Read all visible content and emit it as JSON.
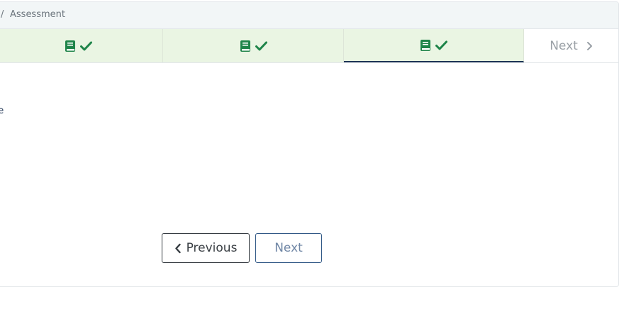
{
  "breadcrumb": {
    "separator": "/",
    "current": "Assessment"
  },
  "tabs": [
    {
      "icon": "book-icon",
      "status": "check-icon",
      "completed": true
    },
    {
      "icon": "book-icon",
      "status": "check-icon",
      "completed": true
    },
    {
      "icon": "book-icon",
      "status": "check-icon",
      "completed": true,
      "active": true
    }
  ],
  "tab_next": {
    "label": "Next",
    "icon": "chevron-right-icon"
  },
  "content": {
    "clipped_text": "ge"
  },
  "nav_buttons": {
    "previous_label": "Previous",
    "next_label": "Next"
  },
  "colors": {
    "tab_background": "#eaf5e3",
    "icon_green": "#1e8449",
    "active_underline": "#1f3557",
    "breadcrumb_background": "#f2f6f7"
  }
}
